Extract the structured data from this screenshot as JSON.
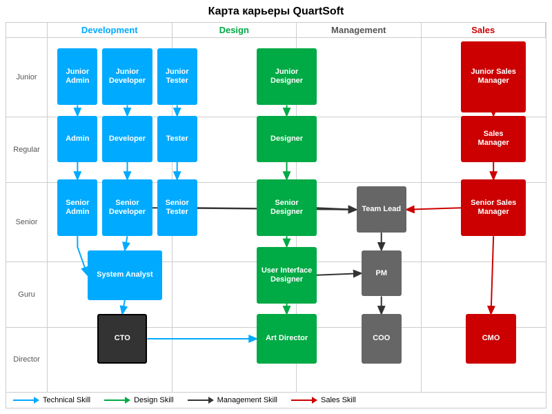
{
  "title": "Карта карьеры QuartSoft",
  "columns": {
    "headers": [
      {
        "label": "Development",
        "class": "dev"
      },
      {
        "label": "Design",
        "class": "design"
      },
      {
        "label": "Management",
        "class": "mgmt"
      },
      {
        "label": "Sales",
        "class": "sales"
      }
    ]
  },
  "rows": [
    {
      "label": "Junior"
    },
    {
      "label": "Regular"
    },
    {
      "label": "Senior"
    },
    {
      "label": "Guru"
    },
    {
      "label": "Director"
    }
  ],
  "legend": [
    {
      "label": "Technical Skill",
      "color": "#00aaff"
    },
    {
      "label": "Design Skill",
      "color": "#00aa44"
    },
    {
      "label": "Management Skill",
      "color": "#333"
    },
    {
      "label": "Sales Skill",
      "color": "#cc0000"
    }
  ],
  "nodes": {
    "junior_admin": "Junior\nAdmin",
    "junior_developer": "Junior\nDeveloper",
    "junior_tester": "Junior\nTester",
    "junior_designer": "Junior\nDesigner",
    "junior_sales_manager": "Junior Sales\nManager",
    "admin": "Admin",
    "developer": "Developer",
    "tester": "Tester",
    "designer": "Designer",
    "sales_manager": "Sales\nManager",
    "senior_admin": "Senior\nAdmin",
    "senior_developer": "Senior\nDeveloper",
    "senior_tester": "Senior\nTester",
    "senior_designer": "Senior\nDesigner",
    "senior_sales_manager": "Senior Sales\nManager",
    "team_lead": "Team Lead",
    "system_analyst": "System Analyst",
    "ui_designer": "User Interface\nDesigner",
    "pm": "PM",
    "cto": "CTO",
    "art_director": "Art Director",
    "coo": "COO",
    "cmo": "CMO"
  }
}
